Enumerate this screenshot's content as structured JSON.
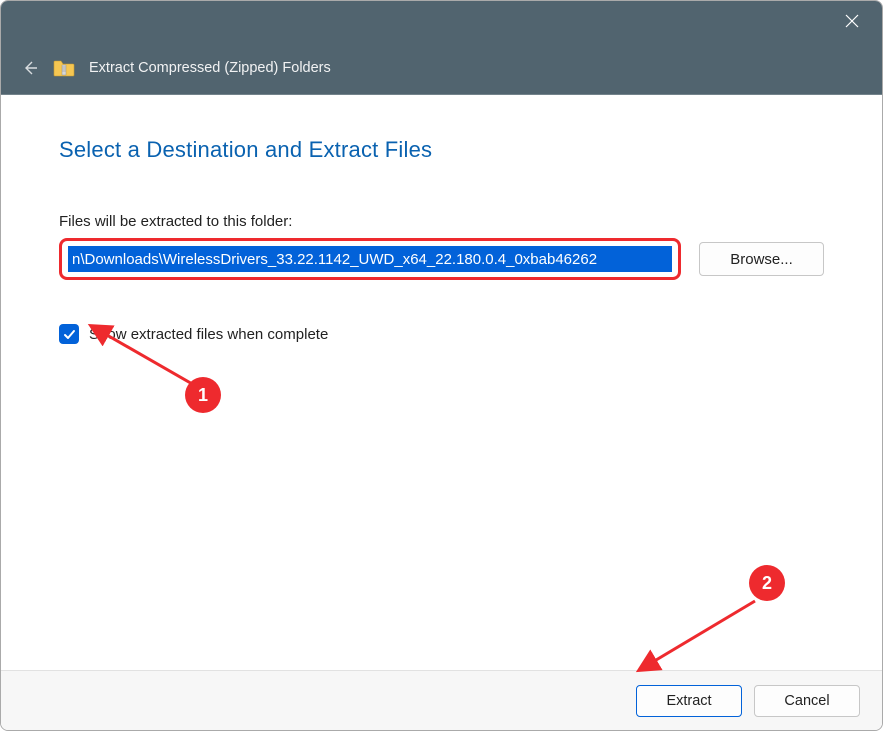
{
  "header": {
    "title": "Extract Compressed (Zipped) Folders"
  },
  "main": {
    "heading": "Select a Destination and Extract Files",
    "field_label": "Files will be extracted to this folder:",
    "path_value": "n\\Downloads\\WirelessDrivers_33.22.1142_UWD_x64_22.180.0.4_0xbab46262",
    "browse_label": "Browse...",
    "checkbox_label": "Show extracted files when complete"
  },
  "footer": {
    "extract_label": "Extract",
    "cancel_label": "Cancel"
  },
  "annotations": {
    "num1": "1",
    "num2": "2"
  }
}
